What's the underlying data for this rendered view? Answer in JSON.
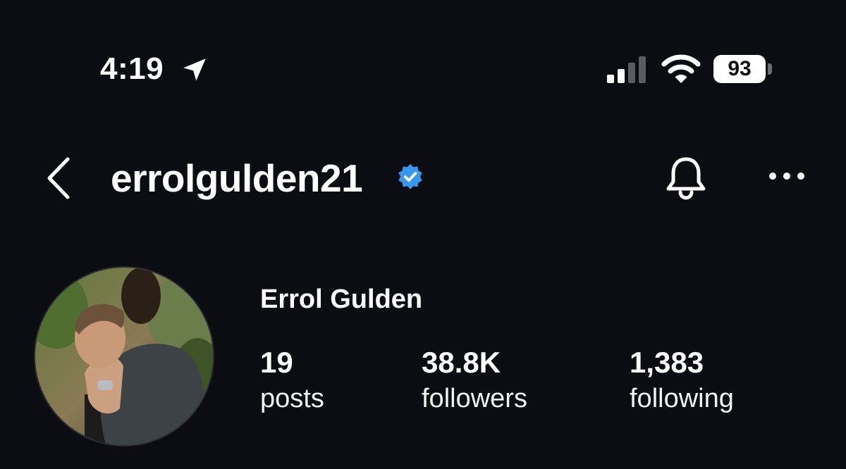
{
  "status_bar": {
    "time": "4:19",
    "battery_level": "93",
    "icons": [
      "location-arrow-icon",
      "cellular-signal-icon",
      "wifi-icon",
      "battery-icon"
    ]
  },
  "header": {
    "username": "errolgulden21",
    "verified": true,
    "icons": [
      "chevron-left-icon",
      "verified-badge-icon",
      "bell-icon",
      "more-horizontal-icon"
    ]
  },
  "profile": {
    "display_name": "Errol Gulden",
    "stats": {
      "posts": {
        "value": "19",
        "label": "posts"
      },
      "followers": {
        "value": "38.8K",
        "label": "followers"
      },
      "following": {
        "value": "1,383",
        "label": "following"
      }
    }
  },
  "colors": {
    "background": "#0b0d12",
    "text": "#ffffff",
    "verified_blue": "#3897f0"
  }
}
